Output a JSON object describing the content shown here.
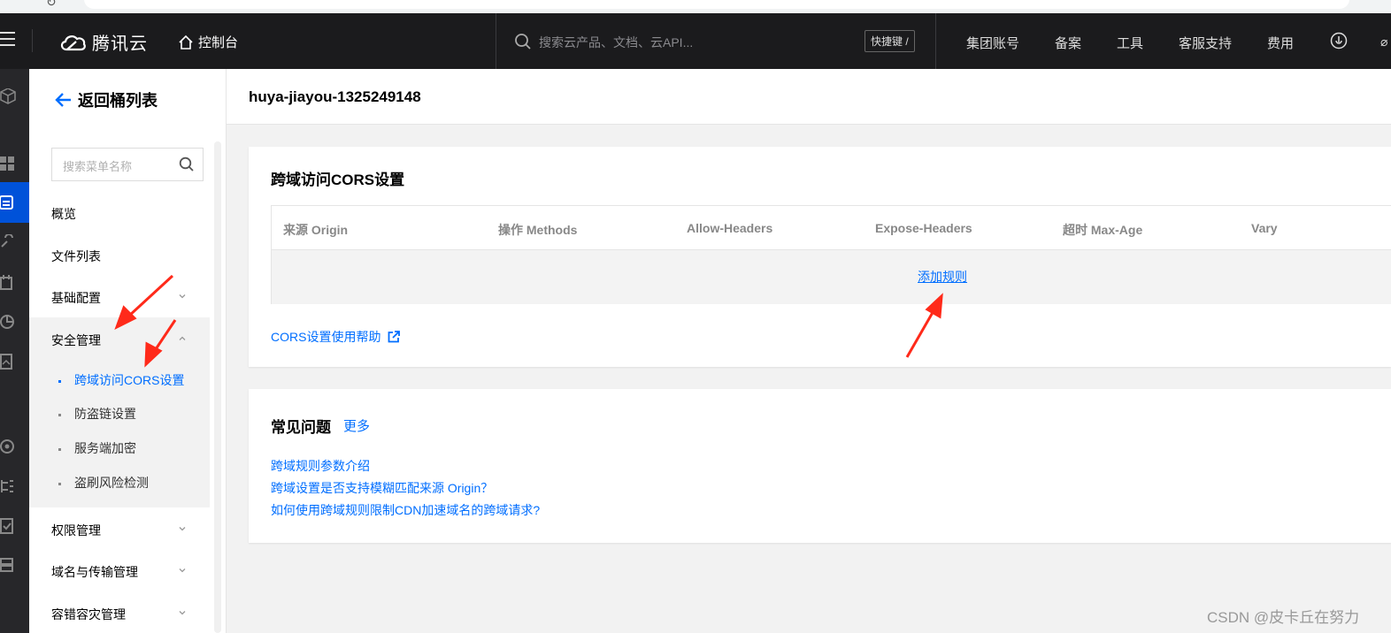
{
  "browser": {
    "refresh_icon": "refresh-icon"
  },
  "topnav": {
    "brand": "腾讯云",
    "console": "控制台",
    "search_placeholder": "搜索云产品、文档、云API...",
    "shortcut": "快捷键 /",
    "links": [
      "集团账号",
      "备案",
      "工具",
      "客服支持",
      "费用"
    ],
    "edge_glyph": "⌀"
  },
  "sidebar": {
    "back_label": "返回桶列表",
    "search_placeholder": "搜索菜单名称",
    "items": [
      "概览",
      "文件列表",
      "基础配置",
      "安全管理",
      "权限管理",
      "域名与传输管理",
      "容错容灾管理"
    ],
    "security_subitems": [
      "跨域访问CORS设置",
      "防盗链设置",
      "服务端加密",
      "盗刷风险检测"
    ]
  },
  "main": {
    "bucket_name": "huya-jiayou-1325249148",
    "cors": {
      "title": "跨域访问CORS设置",
      "columns": [
        "来源 Origin",
        "操作 Methods",
        "Allow-Headers",
        "Expose-Headers",
        "超时 Max-Age",
        "Vary"
      ],
      "add_rule": "添加规则",
      "help_link": "CORS设置使用帮助"
    },
    "faq": {
      "title": "常见问题",
      "more": "更多",
      "items": [
        "跨域规则参数介绍",
        "跨域设置是否支持模糊匹配来源 Origin？",
        "如何使用跨域规则限制CDN加速域名的跨域请求?"
      ]
    }
  },
  "watermark": "CSDN @皮卡丘在努力",
  "colors": {
    "accent": "#006eff",
    "topbar": "#1b1b1d",
    "annotation": "#ff2a1a"
  }
}
